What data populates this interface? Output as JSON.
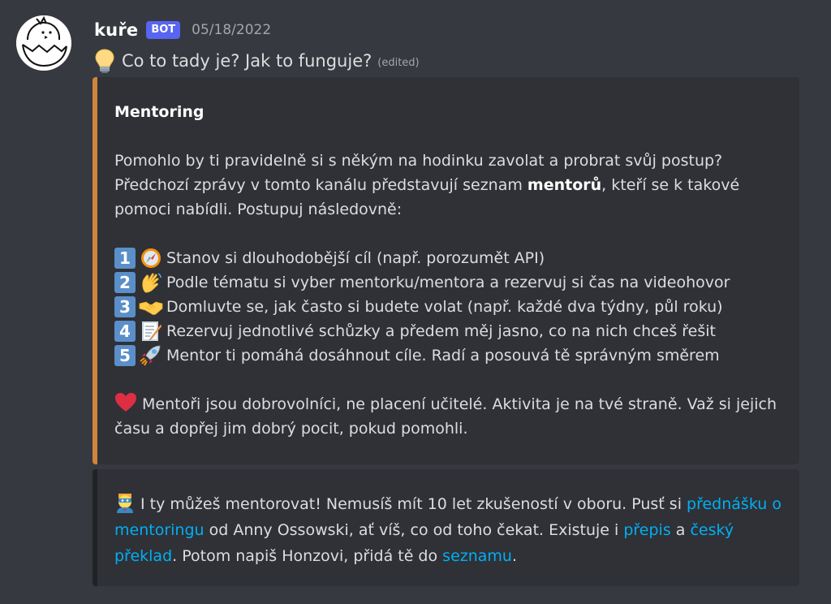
{
  "message": {
    "author": "kuře",
    "bot_badge": "BOT",
    "timestamp": "05/18/2022",
    "text": "Co to tady je? Jak to funguje?",
    "edited": "(edited)",
    "emoji": "lightbulb-icon"
  },
  "embed1": {
    "accent_color": "#d0843c",
    "title": "Mentoring",
    "para_a": "Pomohlo by ti pravidelně si s někým na hodinku zavolat a probrat svůj postup? Předchozí zprávy v tomto kanálu představují seznam ",
    "para_bold": "mentorů",
    "para_b": ", kteří se k takové pomoci nabídli. Postupuj následovně:",
    "steps": [
      {
        "num": "1",
        "icon": "compass-icon",
        "text": "Stanov si dlouhodobější cíl (např. porozumět API)"
      },
      {
        "num": "2",
        "icon": "waving-hand-icon",
        "text": "Podle tématu si vyber mentorku/mentora a rezervuj si čas na videohovor"
      },
      {
        "num": "3",
        "icon": "handshake-icon",
        "text": "Domluvte se, jak často si budete volat (např. každé dva týdny, půl roku)"
      },
      {
        "num": "4",
        "icon": "memo-icon",
        "text": "Rezervuj jednotlivé schůzky a předem měj jasno, co na nich chceš řešit"
      },
      {
        "num": "5",
        "icon": "rocket-icon",
        "text": "Mentor ti pomáhá dosáhnout cíle. Radí a posouvá tě správným směrem"
      }
    ],
    "note": "Mentoři jsou dobrovolníci, ne placení učitelé. Aktivita je na tvé straně. Važ si jejich času a dopřej jim dobrý pocit, pokud pomohli."
  },
  "embed2": {
    "t1": "I ty můžeš mentorovat! Nemusíš mít 10 let zkušeností v oboru. Pusť si ",
    "link1": "přednášku o mentoringu",
    "t2": " od Anny Ossowski, ať víš, co od toho čekat. Existuje i ",
    "link2": "přepis",
    "t3": " a ",
    "link3": "český překlad",
    "t4": ". Potom napiš Honzovi, přidá tě do ",
    "link4": "seznamu",
    "t5": "."
  }
}
